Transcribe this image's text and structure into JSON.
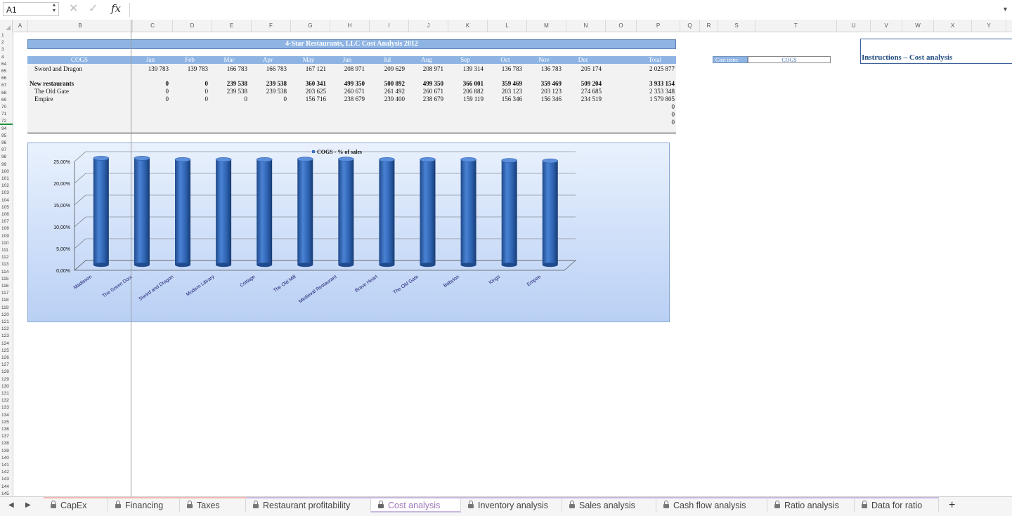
{
  "formula_bar": {
    "name_box": "A1",
    "cancel": "✕",
    "confirm": "✓",
    "fx": "fx",
    "formula": ""
  },
  "columns": [
    "A",
    "B",
    "C",
    "D",
    "E",
    "F",
    "G",
    "H",
    "I",
    "J",
    "K",
    "L",
    "M",
    "N",
    "O",
    "P",
    "Q",
    "R",
    "S",
    "T",
    "U",
    "V",
    "W",
    "X",
    "Y",
    "Z"
  ],
  "rows": [
    "1",
    "2",
    "3",
    "4",
    "64",
    "65",
    "66",
    "67",
    "68",
    "69",
    "70",
    "71",
    "72",
    "94",
    "95",
    "96",
    "97",
    "98",
    "99",
    "100",
    "101",
    "102",
    "103",
    "104",
    "105",
    "106",
    "107",
    "108",
    "109",
    "110",
    "111",
    "112",
    "113",
    "114",
    "115",
    "116",
    "117",
    "118",
    "119",
    "120",
    "121",
    "122",
    "123",
    "124",
    "125",
    "126",
    "127",
    "128",
    "129",
    "130",
    "131",
    "132",
    "133",
    "134",
    "135",
    "136",
    "137",
    "138",
    "139",
    "140",
    "141",
    "142",
    "143",
    "144",
    "145"
  ],
  "sheet": {
    "title": "4-Star Restaurants, LLC Cost Analysis 2012",
    "header": [
      "COGS",
      "Jan",
      "Feb",
      "Mar",
      "Apr",
      "May",
      "Jun",
      "Jul",
      "Aug",
      "Sep",
      "Oct",
      "Nov",
      "Dec",
      "Total"
    ],
    "data_rows": [
      {
        "label": "Sword and Dragon",
        "bold": false,
        "values": [
          "139 783",
          "139 783",
          "166 783",
          "166 783",
          "167 121",
          "208 971",
          "209 629",
          "208 971",
          "139 314",
          "136 783",
          "136 783",
          "205 174",
          "2 025 877"
        ]
      },
      {
        "label": "New restaurants",
        "bold": true,
        "values": [
          "0",
          "0",
          "239 538",
          "239 538",
          "360 341",
          "499 350",
          "500 892",
          "499 350",
          "366 001",
          "359 469",
          "359 469",
          "509 204",
          "3 933 154"
        ]
      },
      {
        "label": "The Old Gate",
        "bold": false,
        "values": [
          "0",
          "0",
          "239 538",
          "239 538",
          "203 625",
          "260 671",
          "261 492",
          "260 671",
          "206 882",
          "203 123",
          "203 123",
          "274 685",
          "2 353 348"
        ]
      },
      {
        "label": "Empire",
        "bold": false,
        "values": [
          "0",
          "0",
          "0",
          "0",
          "156 716",
          "238 679",
          "239 400",
          "238 679",
          "159 119",
          "156 346",
          "156 346",
          "234 519",
          "1 579 805"
        ]
      }
    ],
    "extra_totals": [
      "0",
      "0",
      "0"
    ],
    "cost_item_label": "Cost item:",
    "cost_item_value": "COGS",
    "instructions_title": "Instructions – Cost analysis"
  },
  "chart_data": {
    "type": "bar",
    "title": "",
    "legend": "COGS - % of sales",
    "legend_position": "top",
    "categories": [
      "Madisson",
      "The Green Door",
      "Sword and Dragon",
      "Modern Library",
      "Cottage",
      "The Old Mill",
      "Medieval Restaurant",
      "Brave Heart",
      "The Old Gate",
      "Babylon",
      "Kings",
      "Empire"
    ],
    "series": [
      {
        "name": "COGS - % of sales",
        "values": [
          24.5,
          24.5,
          24.2,
          24.2,
          24.2,
          24.3,
          24.3,
          24.2,
          24.2,
          24.2,
          24.0,
          23.9
        ]
      }
    ],
    "y_ticks": [
      "0,00%",
      "5,00%",
      "10,00%",
      "15,00%",
      "20,00%",
      "25,00%"
    ],
    "ylim": [
      0,
      25
    ],
    "grid": true,
    "bar_color": "#3a6fbd"
  },
  "tabs": [
    {
      "label": "CapEx",
      "active": false,
      "accent": "#f2b8b0"
    },
    {
      "label": "Financing",
      "active": false,
      "accent": "#f2b8b0"
    },
    {
      "label": "Taxes",
      "active": false,
      "accent": "#f2b8b0"
    },
    {
      "label": "Restaurant profitability",
      "active": false,
      "accent": "#c9b8e0"
    },
    {
      "label": "Cost analysis",
      "active": true,
      "accent": "#c9b8e0"
    },
    {
      "label": "Inventory analysis",
      "active": false,
      "accent": "#c9b8e0"
    },
    {
      "label": "Sales analysis",
      "active": false,
      "accent": "#c9b8e0"
    },
    {
      "label": "Cash flow analysis",
      "active": false,
      "accent": "#c9b8e0"
    },
    {
      "label": "Ratio analysis",
      "active": false,
      "accent": "#c9b8e0"
    },
    {
      "label": "Data for ratio",
      "active": false,
      "accent": "#c9b8e0"
    }
  ],
  "add_sheet": "+"
}
